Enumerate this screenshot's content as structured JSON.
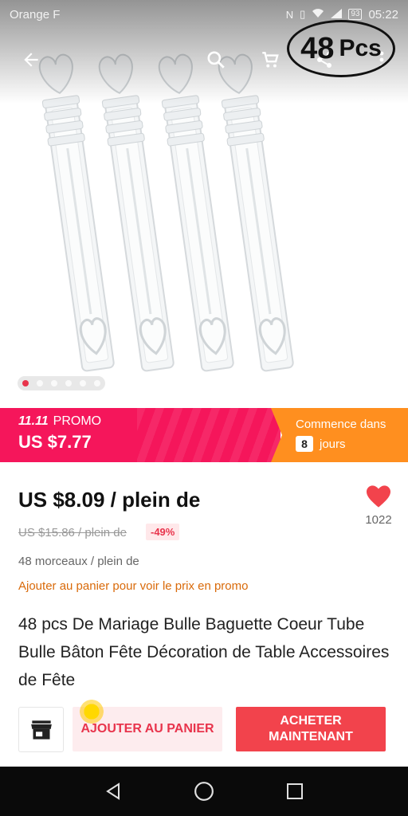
{
  "status_bar": {
    "carrier": "Orange F",
    "battery": "93",
    "time": "05:22"
  },
  "top_bar": {
    "icons": [
      "back-arrow-icon",
      "search-icon",
      "cart-icon",
      "share-icon",
      "more-icon"
    ],
    "badge_count": "48",
    "badge_unit": "Pcs"
  },
  "gallery": {
    "total_images": 6,
    "active_index": 0
  },
  "promo": {
    "event": "11.11",
    "label": "PROMO",
    "price": "US $7.77",
    "starts_label": "Commence dans",
    "days": "8",
    "days_label": "jours",
    "colors": {
      "banner": "#f5165b",
      "countdown": "#ff8f1f"
    }
  },
  "product": {
    "price": "US $8.09 / plein de",
    "old_price": "US $15.86 / plein de",
    "discount": "-49%",
    "wishlist_count": "1022",
    "pieces": "48 morceaux / plein de",
    "promo_hint": "Ajouter au panier pour voir le prix en promo",
    "title": "48 pcs De Mariage Bulle Baguette Coeur Tube Bulle Bâton Fête Décoration de Table Accessoires de Fête"
  },
  "actions": {
    "store_icon": "store-icon",
    "add_to_cart": "AJOUTER AU PANIER",
    "buy_line1": "ACHETER",
    "buy_line2": "MAINTENANT",
    "accent": "#e8344c"
  },
  "nav": {
    "icons": [
      "back-triangle-icon",
      "home-circle-icon",
      "recents-square-icon"
    ]
  }
}
